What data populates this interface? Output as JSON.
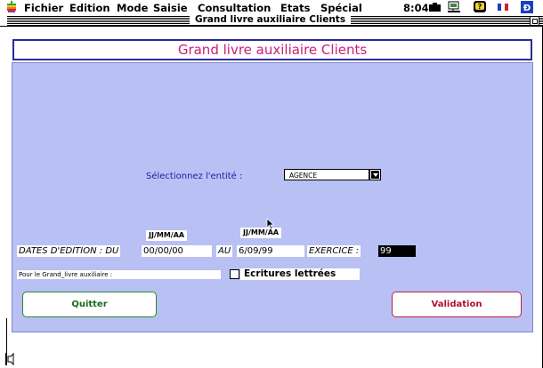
{
  "menubar": {
    "menus": [
      "Fichier",
      "Edition",
      "Mode",
      "Saisie",
      "Consultation",
      "Etats",
      "Spécial"
    ],
    "clock": "8:04",
    "icons": [
      "apple-icon",
      "battery-icon",
      "network-icon",
      "help-icon",
      "flag-icon",
      "keyboard-icon"
    ],
    "apple_colors": [
      "#31a836",
      "#f7c81b",
      "#f47a20",
      "#e0282d",
      "#8c3b95",
      "#1d8ecf"
    ]
  },
  "window": {
    "title": "Grand livre auxiliaire Clients"
  },
  "form": {
    "heading": "Grand livre auxiliaire Clients",
    "entity_label": "Sélectionnez l'entité :",
    "entity_value": "AGENCE",
    "date_format_1": "JJ/MM/AA",
    "date_format_2": "JJ/MM/AA",
    "dates_label": "DATES D'EDITION  : DU",
    "date_from": "00/00/00",
    "au_label": "AU",
    "date_to": "6/09/99",
    "exercice_label": "EXERCICE :",
    "exercice_value": "99",
    "grand_livre_label": "Pour le Grand_livre auxiliaire :",
    "ecritures_label": "Ecritures lettrées",
    "ecritures_checked": false
  },
  "buttons": {
    "quit": "Quitter",
    "validate": "Validation"
  },
  "colors": {
    "panel_bg": "#b8c0f4",
    "heading_text": "#c8207a",
    "heading_border": "#2a2a9a",
    "quit_border": "#2a8a2a",
    "validate_border": "#c02040"
  }
}
